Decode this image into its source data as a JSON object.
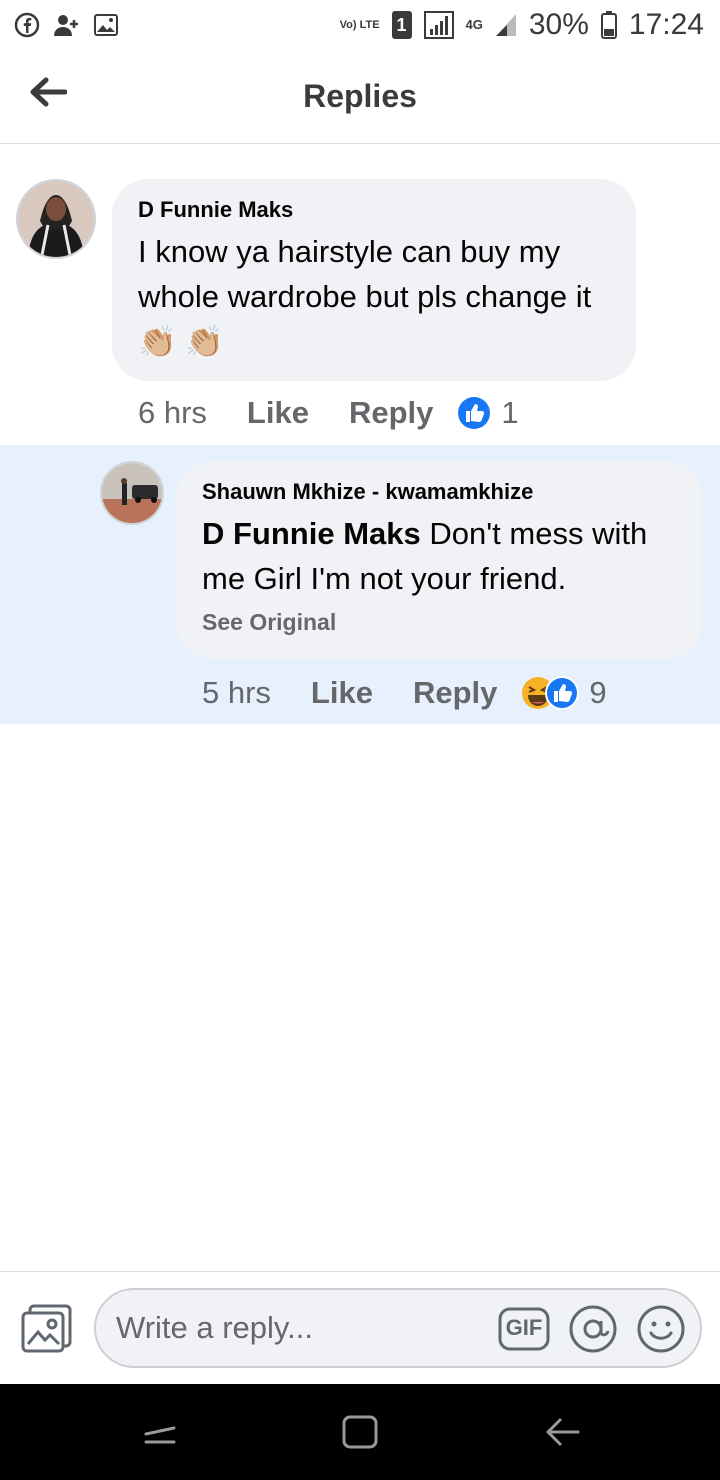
{
  "status_bar": {
    "volte": "Vo) LTE",
    "sim": "1",
    "network": "4G",
    "battery": "30%",
    "time": "17:24"
  },
  "header": {
    "title": "Replies"
  },
  "comments": [
    {
      "author": "D Funnie Maks",
      "text": "I know ya hairstyle can buy my whole wardrobe but pls change it👏🏼 👏🏼",
      "time": "6 hrs",
      "like_label": "Like",
      "reply_label": "Reply",
      "reactions": [
        "like-icon"
      ],
      "reaction_count": "1"
    },
    {
      "author": "Shauwn Mkhize - kwamamkhize",
      "mention": "D Funnie Maks",
      "text": "Don't mess with me Girl I'm not your friend.",
      "see_original": "See Original",
      "time": "5 hrs",
      "like_label": "Like",
      "reply_label": "Reply",
      "reactions": [
        "haha-icon",
        "like-icon"
      ],
      "reaction_count": "9",
      "highlighted": true
    }
  ],
  "composer": {
    "placeholder": "Write a reply...",
    "gif_label": "GIF"
  },
  "colors": {
    "highlight": "#e7f0fd",
    "bubble": "#f0f2f5",
    "like_blue": "#1877f2",
    "meta_gray": "#65676b"
  }
}
